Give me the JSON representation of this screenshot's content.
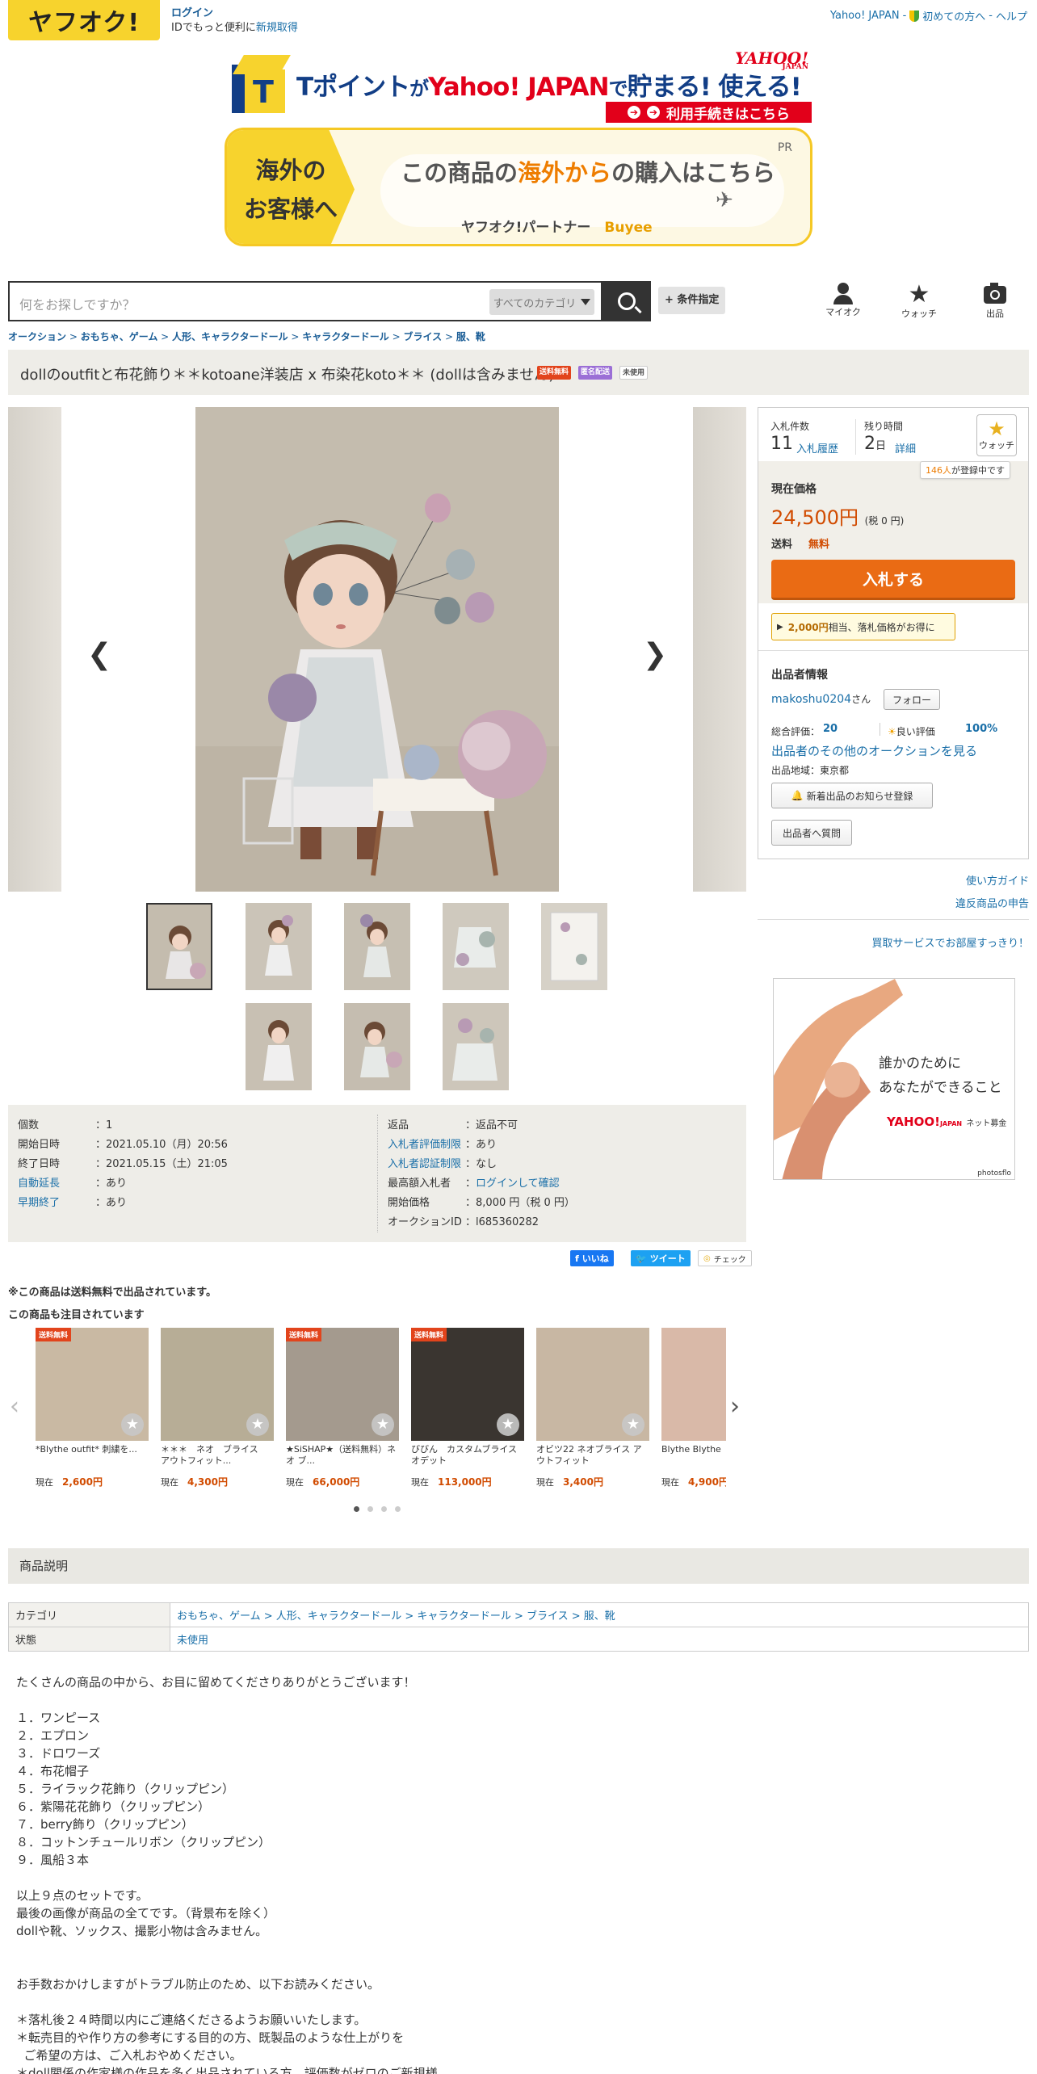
{
  "header": {
    "logo_text": "ヤフオク!",
    "login_label": "ログイン",
    "login_sub": "IDでもっと便利に",
    "register_link": "新規取得",
    "links": [
      "Yahoo! JAPAN",
      "初めての方へ",
      "ヘルプ"
    ]
  },
  "tpoint_banner": {
    "text_a": "Tポイント",
    "text_b": "が",
    "text_c": "Yahoo! JAPAN",
    "text_d": "で",
    "text_e": "貯まる! 使える!",
    "logo": "YAHOO!",
    "logo_sub": "JAPAN",
    "bar_text": "利用手続きはこちら"
  },
  "overseas_banner": {
    "left_line1": "海外の",
    "left_line2": "お客様へ",
    "main_a": "この商品の",
    "main_b": "海外から",
    "main_c": "の購入はこちら",
    "pr": "PR",
    "partner": "ヤフオク!パートナー",
    "buyee": "Buyee"
  },
  "search": {
    "placeholder": "何をお探しですか？",
    "category": "すべてのカテゴリ",
    "condition_button": "+ 条件指定"
  },
  "user_icons": [
    {
      "label": "マイオク"
    },
    {
      "label": "ウォッチ"
    },
    {
      "label": "出品"
    }
  ],
  "breadcrumb": [
    "オークション",
    "おもちゃ、ゲーム",
    "人形、キャラクタードール",
    "キャラクタードール",
    "ブライス",
    "服、靴"
  ],
  "title": {
    "text": "dollのoutfitと布花飾り＊＊kotoane洋装店 x 布染花koto＊＊ (dollは含みません)",
    "badges": [
      {
        "label": "送料無料",
        "color": "#e2441c"
      },
      {
        "label": "匿名配送",
        "color": "#9b6fd6"
      },
      {
        "label": "未使用",
        "color": "#ffffff"
      }
    ]
  },
  "bid_panel": {
    "bids_label": "入札件数",
    "bids_count": "11",
    "bids_link": "入札履歴",
    "time_label": "残り時間",
    "time_value": "2",
    "time_unit": "日",
    "time_link": "詳細",
    "watch_label": "ウォッチ",
    "watch_count": "146人",
    "watch_suffix": "が登録中です",
    "price_label": "現在価格",
    "price": "24,500円",
    "tax": "(税 0 円)",
    "shipping_label": "送料",
    "shipping_value": "無料",
    "bid_button": "入札する",
    "promo_amount": "2,000円",
    "promo_text": "相当、落札価格がお得に"
  },
  "seller": {
    "heading": "出品者情報",
    "name": "makoshu0204",
    "san": "さん",
    "follow": "フォロー",
    "rating_label": "総合評価：",
    "rating": "20",
    "good_label": "良い評価",
    "good_pct": "100%",
    "other_link": "出品者のその他のオークションを見る",
    "region": "出品地域：東京都",
    "notify_button": "新着出品のお知らせ登録",
    "question_button": "出品者へ質問"
  },
  "right_links": [
    "使い方ガイド",
    "違反商品の申告",
    "買取サービスでお部屋すっきり！"
  ],
  "ad": {
    "line1": "誰かのために",
    "line2": "あなたができること",
    "logo": "YAHOO!",
    "logo_sub": "JAPAN",
    "fund": "ネット募金",
    "credit": "photosflo"
  },
  "details_left": [
    {
      "k": "個数",
      "v": "1"
    },
    {
      "k": "開始日時",
      "v": "2021.05.10（月）20:56"
    },
    {
      "k": "終了日時",
      "v": "2021.05.15（土）21:05"
    },
    {
      "k": "自動延長",
      "v": "あり"
    },
    {
      "k": "早期終了",
      "v": "あり"
    }
  ],
  "details_right": [
    {
      "k": "返品",
      "v": "返品不可"
    },
    {
      "k": "入札者評価制限",
      "v": "あり"
    },
    {
      "k": "入札者認証制限",
      "v": "なし"
    },
    {
      "k": "最高額入札者",
      "v": "ログインして確認"
    },
    {
      "k": "開始価格",
      "v": "8,000 円（税 0 円）"
    },
    {
      "k": "オークションID",
      "v": "l685360282"
    }
  ],
  "share": {
    "like": "いいね",
    "tweet": "ツイート",
    "check": "チェック"
  },
  "notices": {
    "free_shipping": "※この商品は送料無料で出品されています。",
    "also_watched": "この商品も注目されています"
  },
  "recommend": [
    {
      "name": "*Blythe outfit* 刺繍を...",
      "price_label": "現在",
      "price": "2,600円",
      "soryo": "送料無料",
      "color": "#c9b9a3"
    },
    {
      "name": "＊＊＊　ネオ　ブライス　アウトフィット...",
      "price_label": "現在",
      "price": "4,300円",
      "soryo": "",
      "color": "#b7ad96"
    },
    {
      "name": "★SiSHAP★（送料無料）ネオ ブ...",
      "price_label": "現在",
      "price": "66,000円",
      "soryo": "送料無料",
      "color": "#a49a8e"
    },
    {
      "name": "びびん　カスタムブライス　オデット",
      "price_label": "現在",
      "price": "113,000円",
      "soryo": "送料無料",
      "color": "#3a3530"
    },
    {
      "name": "オビツ22 ネオブライス アウトフィット",
      "price_label": "現在",
      "price": "3,400円",
      "soryo": "",
      "color": "#c8b7a3"
    },
    {
      "name": "Blythe Blythe",
      "price_label": "現在",
      "price": "4,900円",
      "soryo": "",
      "color": "#d9b9a8"
    }
  ],
  "section_heading": "商品説明",
  "category_table": {
    "cat_label": "カテゴリ",
    "cat_value": "おもちゃ、ゲーム > 人形、キャラクタードール > キャラクタードール > ブライス > 服、靴",
    "state_label": "状態",
    "state_value": "未使用"
  },
  "description": "たくさんの商品の中から、お目に留めてくださりありがとうございます！\n\n１．ワンピース\n２．エプロン\n３．ドロワーズ\n４．布花帽子\n５．ライラック花飾り（クリップピン）\n６．紫陽花花飾り（クリップピン）\n７．berry飾り（クリップピン）\n８．コットンチュールリボン（クリップピン）\n９．風船３本\n\n以上９点のセットです。\n最後の画像が商品の全てです。（背景布を除く）\ndollや靴、ソックス、撮影小物は含みません。\n\n\nお手数おかけしますがトラブル防止のため、以下お読みください。\n\n＊落札後２４時間以内にご連絡くださるようお願いいたします。\n＊転売目的や作り方の参考にする目的の方、既製品のような仕上がりを\n  ご希望の方は、ご入札おやめください。\n＊doll関係の作家様の作品を多く出品されている方、評価数がゼロのご新規様"
}
